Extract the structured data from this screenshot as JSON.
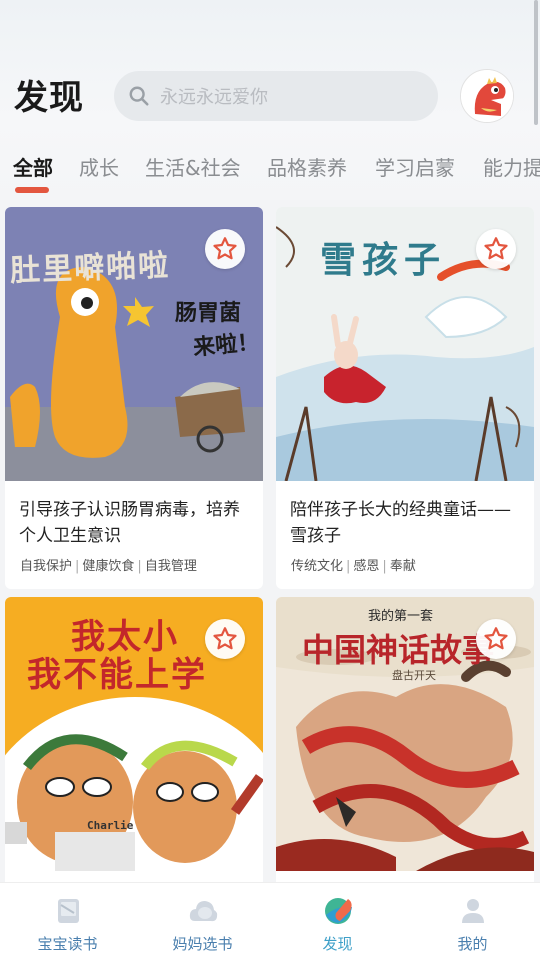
{
  "header": {
    "title": "发现",
    "search_placeholder": "永远永远爱你"
  },
  "tabs": [
    "全部",
    "成长",
    "生活&社会",
    "品格素养",
    "学习启蒙",
    "能力提"
  ],
  "active_tab": 0,
  "cards": [
    {
      "title_line1": "引导孩子认识肠胃病毒，培养",
      "title_line2": "个人卫生意识",
      "tags": [
        "自我保护",
        "健康饮食",
        "自我管理"
      ],
      "cover_text_top": "肠胃菌",
      "cover_text_bottom": "来啦！",
      "cover_header": "肚里噼啪啦"
    },
    {
      "title_line1": "陪伴孩子长大的经典童话——",
      "title_line2": "雪孩子",
      "tags": [
        "传统文化",
        "感恩",
        "奉献"
      ],
      "cover_text": "雪孩子"
    },
    {
      "cover_line1": "我太小",
      "cover_line2": "我不能上学",
      "cover_name": "Charlie"
    },
    {
      "cover_small": "我的第一套",
      "cover_title": "中国神话故事",
      "cover_subtitle": "盘古开天"
    }
  ],
  "bottom_nav": [
    {
      "label": "宝宝读书",
      "icon": "book-icon"
    },
    {
      "label": "妈妈选书",
      "icon": "cloud-icon"
    },
    {
      "label": "发现",
      "icon": "planet-icon"
    },
    {
      "label": "我的",
      "icon": "person-icon"
    }
  ],
  "active_nav": 2,
  "colors": {
    "accent": "#e3563f",
    "nav_label": "#4a7fae",
    "tab_inactive": "#8a8d91"
  }
}
